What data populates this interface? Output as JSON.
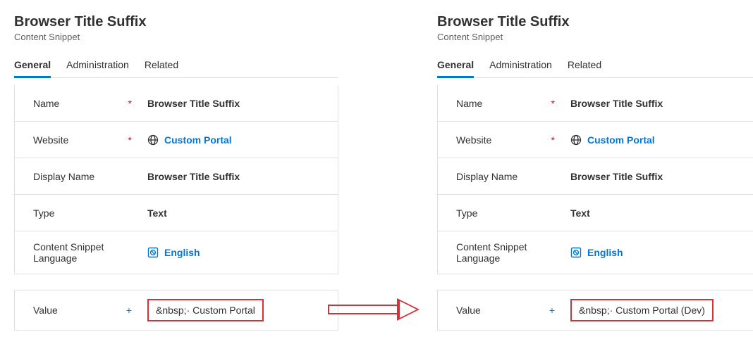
{
  "panels": [
    {
      "title": "Browser Title Suffix",
      "subtitle": "Content Snippet",
      "tabs": [
        {
          "label": "General",
          "active": true
        },
        {
          "label": "Administration",
          "active": false
        },
        {
          "label": "Related",
          "active": false
        }
      ],
      "fields": {
        "name": {
          "label": "Name",
          "value": "Browser Title Suffix",
          "required": true
        },
        "website": {
          "label": "Website",
          "value": "Custom Portal",
          "required": true
        },
        "display_name": {
          "label": "Display Name",
          "value": "Browser Title Suffix"
        },
        "type": {
          "label": "Type",
          "value": "Text"
        },
        "language": {
          "label": "Content Snippet Language",
          "value": "English"
        }
      },
      "value_field": {
        "label": "Value",
        "value": "&nbsp;· Custom Portal",
        "recommended": true
      }
    },
    {
      "title": "Browser Title Suffix",
      "subtitle": "Content Snippet",
      "tabs": [
        {
          "label": "General",
          "active": true
        },
        {
          "label": "Administration",
          "active": false
        },
        {
          "label": "Related",
          "active": false
        }
      ],
      "fields": {
        "name": {
          "label": "Name",
          "value": "Browser Title Suffix",
          "required": true
        },
        "website": {
          "label": "Website",
          "value": "Custom Portal",
          "required": true
        },
        "display_name": {
          "label": "Display Name",
          "value": "Browser Title Suffix"
        },
        "type": {
          "label": "Type",
          "value": "Text"
        },
        "language": {
          "label": "Content Snippet Language",
          "value": "English"
        }
      },
      "value_field": {
        "label": "Value",
        "value": "&nbsp;· Custom Portal (Dev)",
        "recommended": true
      }
    }
  ]
}
